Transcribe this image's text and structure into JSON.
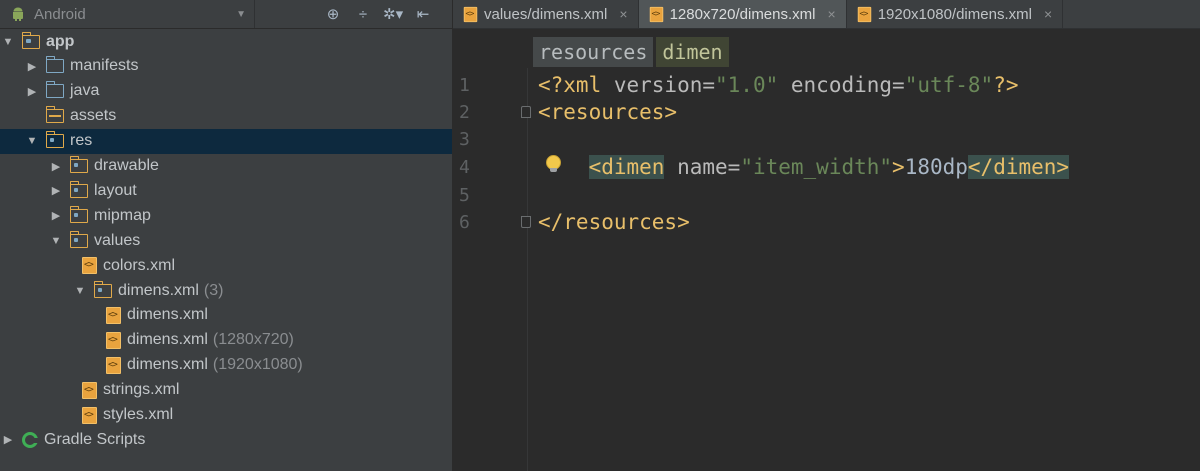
{
  "project_panel": {
    "view_selector": "Android",
    "toolbar_icons": [
      "sync-icon",
      "collapse-icon",
      "settings-icon",
      "hide-icon"
    ],
    "tree": [
      {
        "label": "app",
        "level": 0,
        "expanded": true,
        "icon": "app-module-folder-icon",
        "bold": true
      },
      {
        "label": "manifests",
        "level": 1,
        "expanded": false,
        "icon": "folder-icon"
      },
      {
        "label": "java",
        "level": 1,
        "expanded": false,
        "icon": "folder-icon"
      },
      {
        "label": "assets",
        "level": 1,
        "leaf": true,
        "icon": "assets-folder-icon"
      },
      {
        "label": "res",
        "level": 1,
        "expanded": true,
        "icon": "res-folder-icon",
        "selected": true
      },
      {
        "label": "drawable",
        "level": 2,
        "expanded": false,
        "icon": "res-folder-icon"
      },
      {
        "label": "layout",
        "level": 2,
        "expanded": false,
        "icon": "res-folder-icon"
      },
      {
        "label": "mipmap",
        "level": 2,
        "expanded": false,
        "icon": "res-folder-icon"
      },
      {
        "label": "values",
        "level": 2,
        "expanded": true,
        "icon": "res-folder-icon"
      },
      {
        "label": "colors.xml",
        "level": 3,
        "leaf": true,
        "icon": "xml-file-icon"
      },
      {
        "label": "dimens.xml",
        "qualifier": "(3)",
        "level": 3,
        "expanded": true,
        "icon": "res-folder-icon"
      },
      {
        "label": "dimens.xml",
        "level": 4,
        "leaf": true,
        "icon": "xml-file-icon"
      },
      {
        "label": "dimens.xml",
        "qualifier": "(1280x720)",
        "level": 4,
        "leaf": true,
        "icon": "xml-file-icon"
      },
      {
        "label": "dimens.xml",
        "qualifier": "(1920x1080)",
        "level": 4,
        "leaf": true,
        "icon": "xml-file-icon"
      },
      {
        "label": "strings.xml",
        "level": 3,
        "leaf": true,
        "icon": "xml-file-icon"
      },
      {
        "label": "styles.xml",
        "level": 3,
        "leaf": true,
        "icon": "xml-file-icon"
      },
      {
        "label": "Gradle Scripts",
        "level": 0,
        "expanded": false,
        "icon": "gradle-icon"
      }
    ]
  },
  "editor": {
    "tabs": [
      {
        "label": "values/dimens.xml",
        "active": false
      },
      {
        "label": "1280x720/dimens.xml",
        "active": true
      },
      {
        "label": "1920x1080/dimens.xml",
        "active": false
      }
    ],
    "close_glyph": "×",
    "breadcrumbs": [
      "resources",
      "dimen"
    ],
    "line_numbers": [
      "1",
      "2",
      "3",
      "4",
      "5",
      "6"
    ],
    "code": {
      "line1": {
        "open": "<?xml ",
        "version_attr": "version=",
        "version_val": "\"1.0\"",
        "space": " ",
        "enc_attr": "encoding=",
        "enc_val": "\"utf-8\"",
        "close": "?>"
      },
      "line2": {
        "tag": "<resources>"
      },
      "line4": {
        "indent": "    ",
        "open_tag": "<dimen",
        "space": " ",
        "attr": "name=",
        "attr_val": "\"item_width\"",
        "gt": ">",
        "text": "180dp",
        "close_tag": "</dimen>"
      },
      "line6": {
        "tag": "</resources>"
      }
    }
  },
  "colors": {
    "panel_bg": "#3c3f41",
    "editor_bg": "#2b2b2b",
    "selection": "#0d293e",
    "xml_tag": "#e8bf6a",
    "xml_value": "#6a8759",
    "tag_highlight": "#3b514d"
  }
}
